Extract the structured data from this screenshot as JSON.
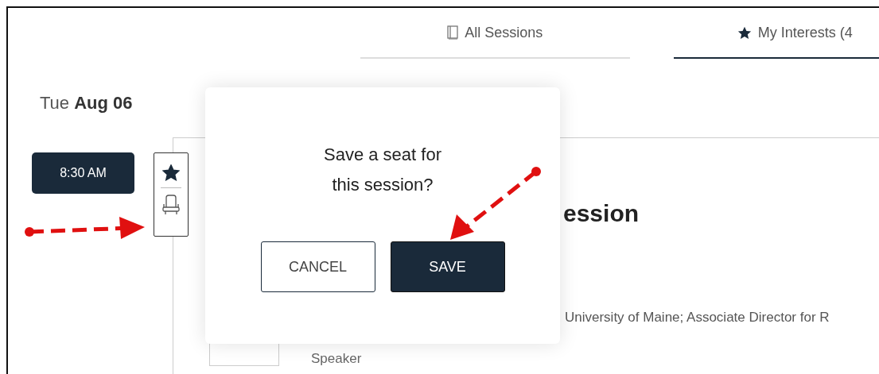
{
  "tabs": [
    {
      "label": "All Sessions",
      "selected": false
    },
    {
      "label": "My Interests (4",
      "selected": true
    }
  ],
  "date": {
    "weekday": "Tue",
    "day": "Aug 06"
  },
  "session": {
    "time": "8:30 AM",
    "interested": true,
    "title": "ession",
    "affiliation": "University of Maine; Associate Director for R",
    "speaker": {
      "role": "Speaker"
    }
  },
  "dialog": {
    "message_lines": [
      "Save a seat for",
      "this session?"
    ],
    "buttons": [
      {
        "label": "CANCEL",
        "kind": "secondary"
      },
      {
        "label": "SAVE",
        "kind": "primary"
      }
    ]
  }
}
